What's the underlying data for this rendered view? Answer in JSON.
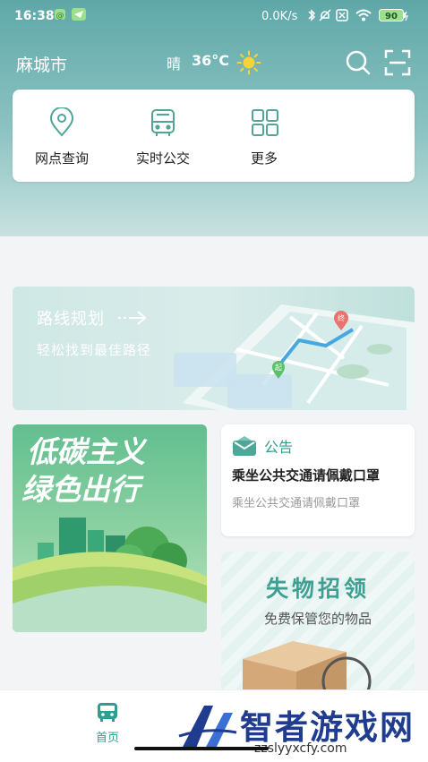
{
  "status_bar": {
    "time": "16:38",
    "network_speed": "0.0K/s",
    "battery": "90"
  },
  "header": {
    "city": "麻城市",
    "weather": "晴",
    "temperature": "36°C"
  },
  "menu": [
    {
      "label": "网点查询",
      "icon": "location-pin-icon"
    },
    {
      "label": "实时公交",
      "icon": "bus-icon"
    },
    {
      "label": "更多",
      "icon": "grid-icon"
    }
  ],
  "route_banner": {
    "title": "路线规划",
    "subtitle": "轻松找到最佳路径",
    "map_markers": {
      "start": "起",
      "end": "终"
    }
  },
  "promo": {
    "line1": "低碳主义",
    "line2": "绿色出行"
  },
  "notice": {
    "tag": "公告",
    "title": "乘坐公共交通请佩戴口罩",
    "subtitle": "乘坐公共交通请佩戴口罩"
  },
  "lost_found": {
    "title": "失物招领",
    "subtitle": "免费保管您的物品"
  },
  "bottom_nav": [
    {
      "label": "首页",
      "icon": "bus-home-icon"
    }
  ],
  "watermark": {
    "brand": "智者游戏网",
    "url": "zzslyyxcfy.com"
  },
  "colors": {
    "accent": "#2f9d8f",
    "header_top": "#5fa8a8",
    "promo_green": "#62be8f"
  }
}
